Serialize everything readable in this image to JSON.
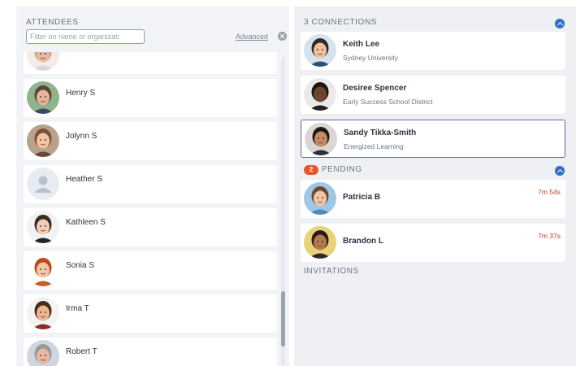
{
  "attendees": {
    "title": "ATTENDEES",
    "filter_placeholder": "Filter on name or organizati",
    "advanced_label": "Advanced",
    "items": [
      {
        "name": "",
        "skin": "#e9b9a0",
        "hair": "#c9a27a",
        "bg": "#f3ece8",
        "shirt": "#d7d9de"
      },
      {
        "name": "Henry S",
        "skin": "#e7b49a",
        "hair": "#5a4636",
        "bg": "#8fb38a",
        "shirt": "#3c4a63"
      },
      {
        "name": "Jolynn S",
        "skin": "#f0c4a4",
        "hair": "#7b5232",
        "bg": "#b8a28f",
        "shirt": "#6c4a3b"
      },
      {
        "name": "Heather S",
        "placeholder": true
      },
      {
        "name": "Kathleen S",
        "skin": "#f1cdb7",
        "hair": "#3a2a22",
        "bg": "#f2f2f2",
        "shirt": "#262626"
      },
      {
        "name": "Sonia S",
        "skin": "#f2c7a6",
        "hair": "#c2471d",
        "bg": "#ffffff",
        "shirt": "#c95a2c"
      },
      {
        "name": "Irma T",
        "skin": "#e9b592",
        "hair": "#4b2a1a",
        "bg": "#f3f3f3",
        "shirt": "#8d2b2b"
      },
      {
        "name": "Robert T",
        "skin": "#e6b9a2",
        "hair": "#9a9a9a",
        "bg": "#cfd6df",
        "shirt": "#2e3e55"
      }
    ]
  },
  "connections": {
    "title": "3 CONNECTIONS",
    "items": [
      {
        "name": "Keith Lee",
        "org": "Sydney University",
        "selected": false,
        "skin": "#f0c19c",
        "hair": "#2f2a26",
        "bg": "#d6e3ef",
        "shirt": "#2e4f7a"
      },
      {
        "name": "Desiree Spencer",
        "org": "Early Success School District",
        "selected": false,
        "skin": "#6f4530",
        "hair": "#1e1512",
        "bg": "#e9e9e9",
        "shirt": "#1f1f1f"
      },
      {
        "name": "Sandy Tikka-Smith",
        "org": "Energized Learning",
        "selected": true,
        "skin": "#c68b66",
        "hair": "#1d1714",
        "bg": "#d9d6d3",
        "shirt": "#2a2f3a"
      }
    ]
  },
  "pending": {
    "count": "2",
    "title": "PENDING",
    "items": [
      {
        "name": "Patricia B",
        "timer": "7m 54s",
        "skin": "#f1c6a6",
        "hair": "#6b4a33",
        "bg": "#9fc7e6",
        "shirt": "#4d8abf"
      },
      {
        "name": "Brandon L",
        "timer": "7m 37s",
        "skin": "#b57a52",
        "hair": "#2b1d15",
        "bg": "#e9d27a",
        "shirt": "#2c2c2c"
      }
    ]
  },
  "invitations": {
    "title": "INVITATIONS"
  },
  "colors": {
    "accent": "#2f6fc7",
    "badge": "#e8572a",
    "timer": "#c0392b"
  }
}
